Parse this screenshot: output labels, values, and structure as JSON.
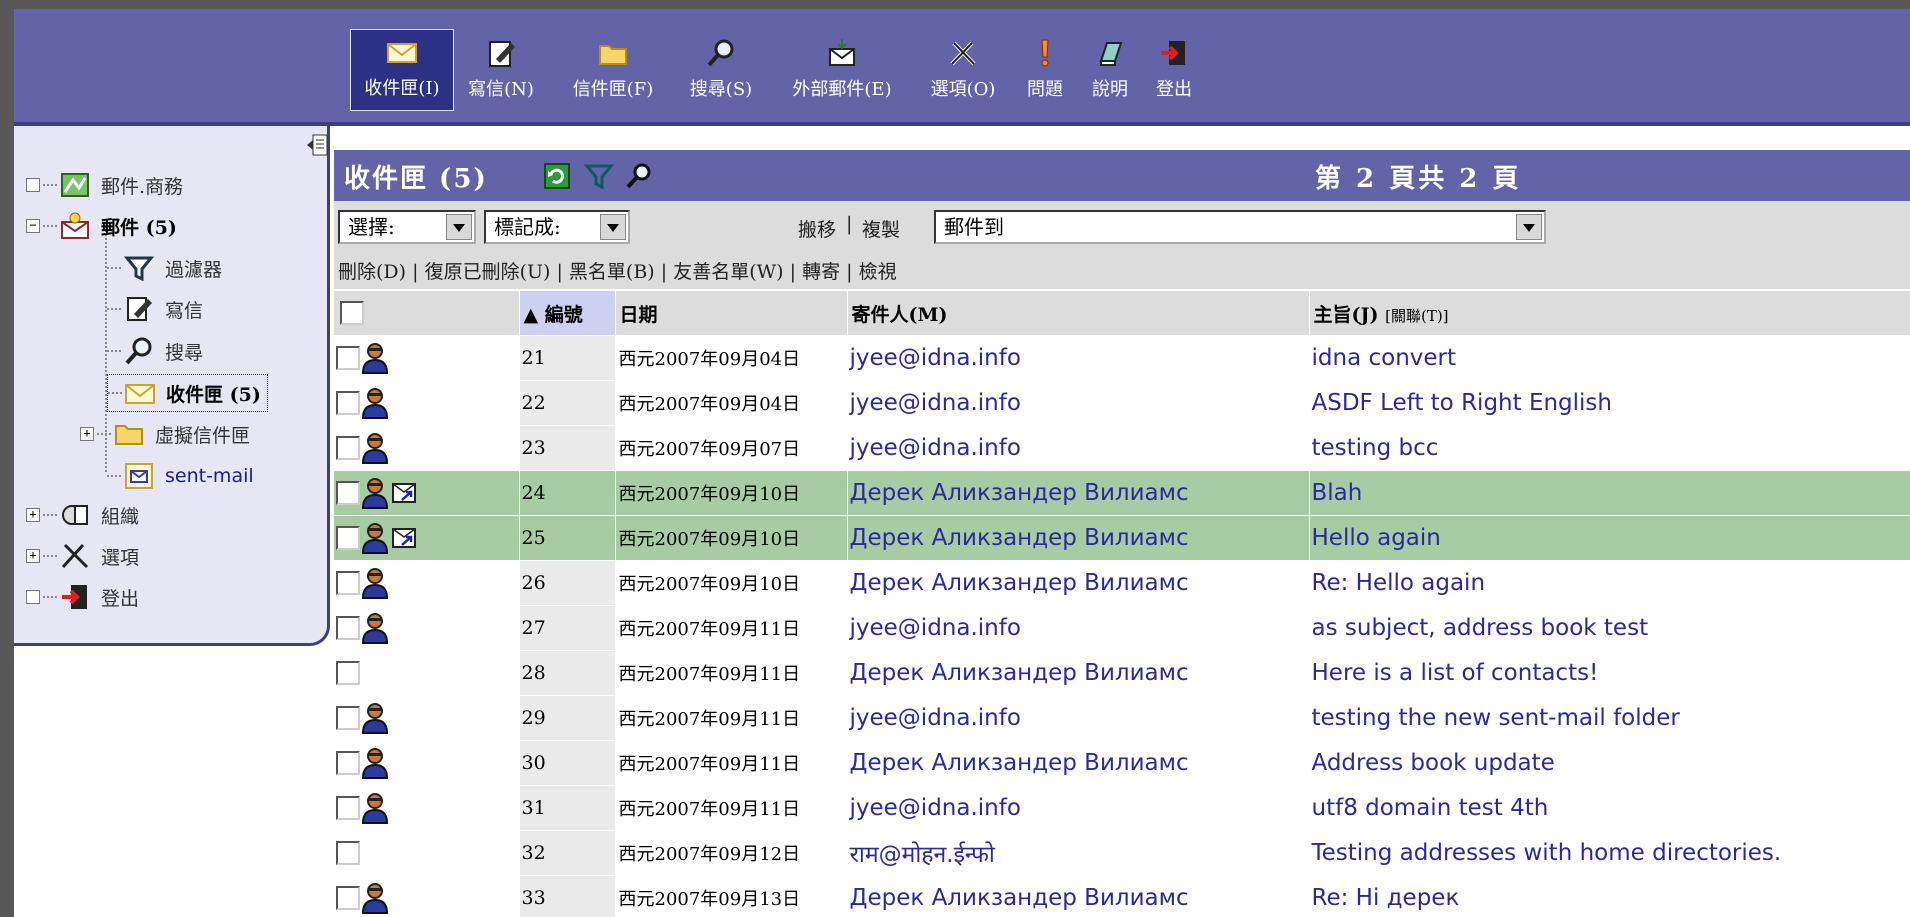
{
  "toolbar": {
    "buttons": [
      {
        "label": "收件匣(I)",
        "icon": "envelope-icon",
        "active": true
      },
      {
        "label": "寫信(N)",
        "icon": "compose-icon"
      },
      {
        "label": "信件匣(F)",
        "icon": "folder-icon"
      },
      {
        "label": "搜尋(S)",
        "icon": "magnifier-icon"
      },
      {
        "label": "外部郵件(E)",
        "icon": "external-mail-icon"
      },
      {
        "label": "選項(O)",
        "icon": "tools-icon"
      },
      {
        "label": "問題",
        "icon": "problem-icon"
      },
      {
        "label": "說明",
        "icon": "help-book-icon"
      },
      {
        "label": "登出",
        "icon": "logout-icon"
      }
    ]
  },
  "sidebar": {
    "items": [
      {
        "label": "郵件.商務",
        "icon": "business-map-icon"
      },
      {
        "label": "郵件 (5)",
        "icon": "mail-icon"
      },
      {
        "label": "過濾器",
        "icon": "filter-icon"
      },
      {
        "label": "寫信",
        "icon": "compose-icon"
      },
      {
        "label": "搜尋",
        "icon": "magnifier-icon"
      },
      {
        "label": "收件匣 (5)",
        "icon": "envelope-icon"
      },
      {
        "label": "虛擬信件匣",
        "icon": "folder-icon"
      },
      {
        "label": "sent-mail",
        "icon": "sent-mail-icon"
      },
      {
        "label": "組織",
        "icon": "organizer-icon"
      },
      {
        "label": "選項",
        "icon": "tools-icon"
      },
      {
        "label": "登出",
        "icon": "logout-icon"
      }
    ]
  },
  "mailbox": {
    "title": "收件匣 (5)",
    "pager": "第 2 頁共 2 頁"
  },
  "controls": {
    "select_label": "選擇:",
    "mark_label": "標記成:",
    "move_label": "搬移",
    "copy_label": "複製",
    "target_folder": "郵件到",
    "actions": [
      "刪除(D)",
      "復原已刪除(U)",
      "黑名單(B)",
      "友善名單(W)",
      "轉寄",
      "檢視"
    ]
  },
  "table": {
    "columns": {
      "number": "編號",
      "date": "日期",
      "from": "寄件人(M)",
      "subject": "主旨(J)",
      "thread": "[關聯(T)]"
    },
    "rows": [
      {
        "num": "21",
        "date": "西元2007年09月04日",
        "from": "jyee@idna.info",
        "subject": "idna convert",
        "person": true,
        "forwarded": false,
        "highlight": false
      },
      {
        "num": "22",
        "date": "西元2007年09月04日",
        "from": "jyee@idna.info",
        "subject": "ASDF Left to Right English",
        "person": true,
        "forwarded": false,
        "highlight": false
      },
      {
        "num": "23",
        "date": "西元2007年09月07日",
        "from": "jyee@idna.info",
        "subject": "testing bcc",
        "person": true,
        "forwarded": false,
        "highlight": false
      },
      {
        "num": "24",
        "date": "西元2007年09月10日",
        "from": "Дерек Аликзандер Вилиамс",
        "subject": "Blah",
        "person": true,
        "forwarded": true,
        "highlight": true
      },
      {
        "num": "25",
        "date": "西元2007年09月10日",
        "from": "Дерек Аликзандер Вилиамс",
        "subject": "Hello again",
        "person": true,
        "forwarded": true,
        "highlight": true
      },
      {
        "num": "26",
        "date": "西元2007年09月10日",
        "from": "Дерек Аликзандер Вилиамс",
        "subject": "Re: Hello again",
        "person": true,
        "forwarded": false,
        "highlight": false
      },
      {
        "num": "27",
        "date": "西元2007年09月11日",
        "from": "jyee@idna.info",
        "subject": "as subject, address book test",
        "person": true,
        "forwarded": false,
        "highlight": false
      },
      {
        "num": "28",
        "date": "西元2007年09月11日",
        "from": "Дерек Аликзандер Вилиамс",
        "subject": "Here is a list of contacts!",
        "person": false,
        "forwarded": false,
        "highlight": false
      },
      {
        "num": "29",
        "date": "西元2007年09月11日",
        "from": "jyee@idna.info",
        "subject": "testing the new sent-mail folder",
        "person": true,
        "forwarded": false,
        "highlight": false
      },
      {
        "num": "30",
        "date": "西元2007年09月11日",
        "from": "Дерек Аликзандер Вилиамс",
        "subject": "Address book update",
        "person": true,
        "forwarded": false,
        "highlight": false
      },
      {
        "num": "31",
        "date": "西元2007年09月11日",
        "from": "jyee@idna.info",
        "subject": "utf8 domain test 4th",
        "person": true,
        "forwarded": false,
        "highlight": false
      },
      {
        "num": "32",
        "date": "西元2007年09月12日",
        "from": "राम@मोहन.ईन्फो",
        "subject": "Testing addresses with home directories.",
        "person": false,
        "forwarded": false,
        "highlight": false
      },
      {
        "num": "33",
        "date": "西元2007年09月13日",
        "from": "Дерек Аликзандер Вилиамс",
        "subject": "Re: Hi дерек",
        "person": true,
        "forwarded": false,
        "highlight": false
      }
    ]
  },
  "colors": {
    "toolbar_bg": "#6264a7",
    "active_button_bg": "#2c3185",
    "sidebar_bg": "#e6e6f4",
    "link": "#2a2a9a",
    "highlight_row": "#a7cca4"
  }
}
